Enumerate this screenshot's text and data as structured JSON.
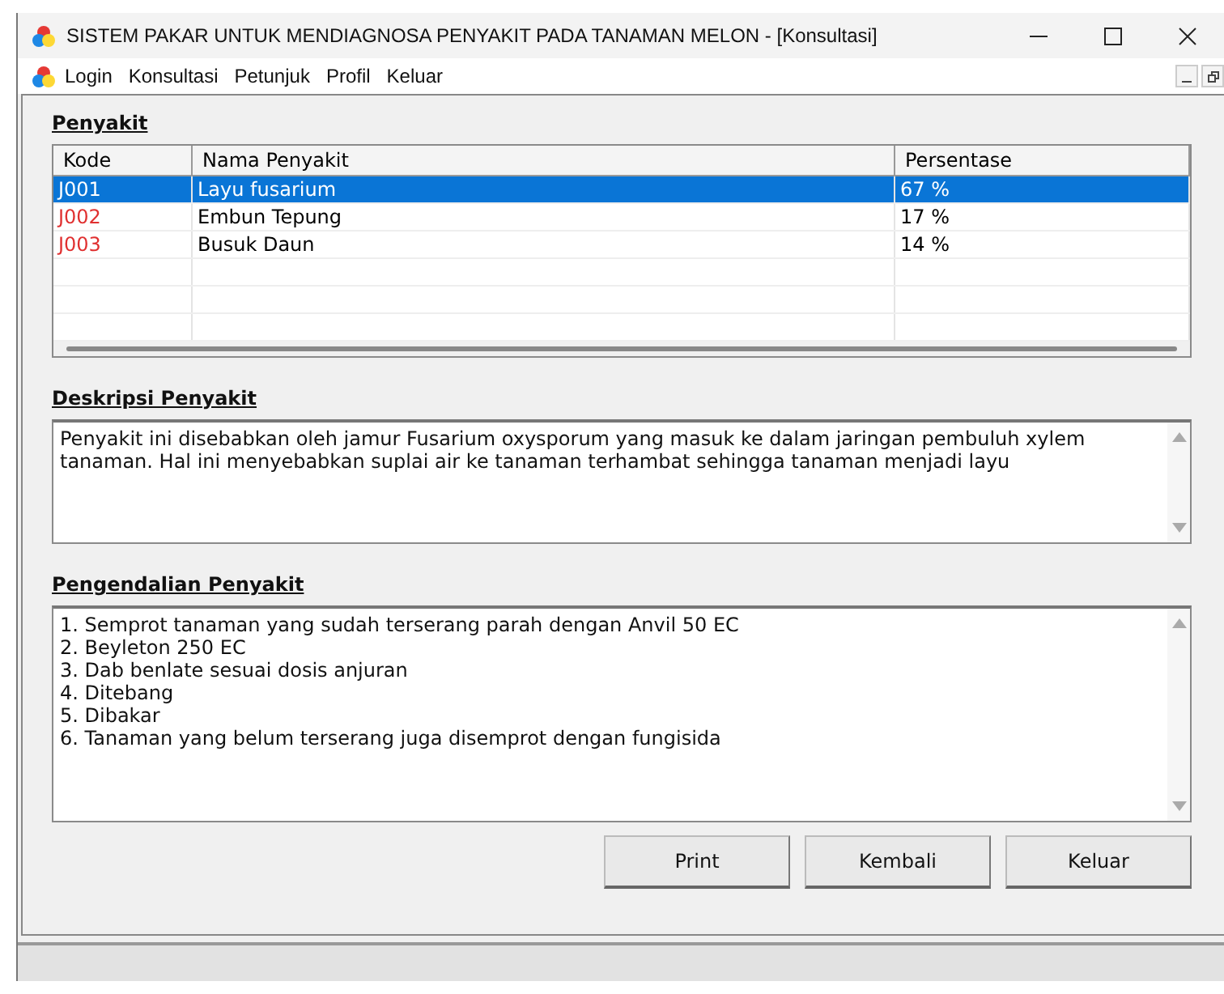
{
  "window": {
    "title": "SISTEM  PAKAR UNTUK MENDIAGNOSA PENYAKIT PADA TANAMAN MELON - [Konsultasi]"
  },
  "menu": [
    "Login",
    "Konsultasi",
    "Petunjuk",
    "Profil",
    "Keluar"
  ],
  "penyakit": {
    "heading": "Penyakit",
    "columns": [
      "Kode",
      "Nama Penyakit",
      "Persentase"
    ],
    "rows": [
      {
        "cells": [
          "J001",
          "Layu fusarium",
          "67 %"
        ],
        "selected": true
      },
      {
        "cells": [
          "J002",
          "Embun Tepung",
          "17 %"
        ],
        "selected": false
      },
      {
        "cells": [
          "J003",
          "Busuk Daun",
          "14 %"
        ],
        "selected": false
      }
    ]
  },
  "deskripsi": {
    "heading": "Deskripsi Penyakit",
    "text": "Penyakit ini disebabkan oleh jamur Fusarium oxysporum yang masuk ke dalam jaringan pembuluh xylem tanaman. Hal ini menyebabkan suplai air ke tanaman terhambat sehingga tanaman menjadi layu"
  },
  "pengendalian": {
    "heading": "Pengendalian Penyakit",
    "lines": [
      "1. Semprot tanaman yang sudah terserang parah dengan Anvil 50 EC",
      "2. Beyleton 250 EC",
      "3. Dab benlate sesuai dosis anjuran",
      "4. Ditebang",
      "5. Dibakar",
      "6. Tanaman yang belum terserang juga disemprot dengan fungisida"
    ]
  },
  "buttons": [
    "Print",
    "Kembali",
    "Keluar"
  ]
}
